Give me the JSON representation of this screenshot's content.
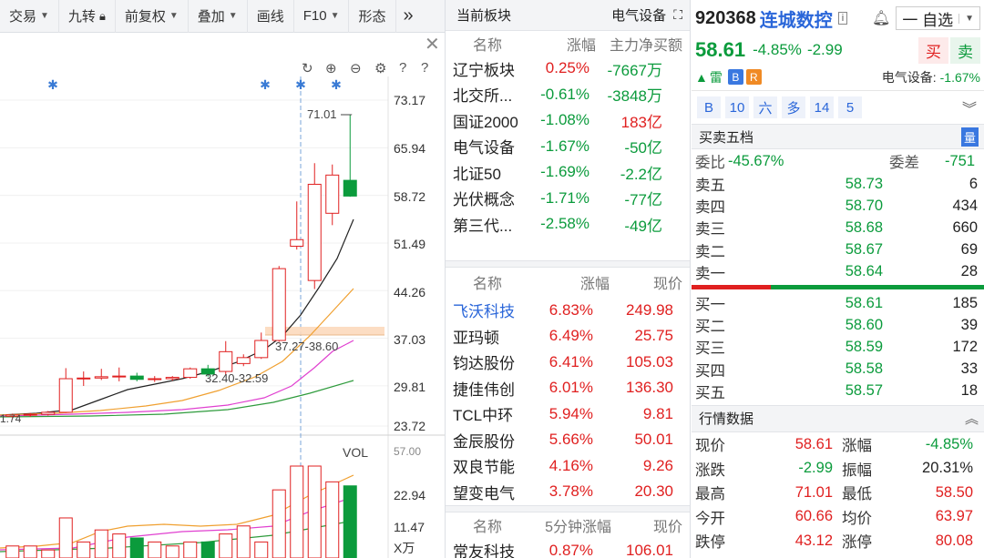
{
  "toolbar": {
    "items": [
      "交易",
      "九转",
      "前复权",
      "叠加",
      "画线",
      "F10",
      "形态"
    ]
  },
  "chart": {
    "y_ticks": [
      "73.17",
      "65.94",
      "58.72",
      "51.49",
      "44.26",
      "37.03",
      "29.81",
      "23.72"
    ],
    "vol_label": "VOL",
    "vol_ticks": [
      "22.94",
      "11.47"
    ],
    "vol_unit": "X万",
    "annotations": {
      "high": "71.01",
      "range1": "37.27-38.60",
      "range2": "32.40-32.59",
      "left_edge": "1.74",
      "left_edge_vol": "57.00"
    }
  },
  "chart_data": {
    "type": "candlestick",
    "y_axis_ticks": [
      73.17,
      65.94,
      58.72,
      51.49,
      44.26,
      37.03,
      29.81,
      23.72
    ],
    "candles": [
      {
        "open": 25.2,
        "high": 25.6,
        "low": 24.9,
        "close": 25.4
      },
      {
        "open": 25.4,
        "high": 25.7,
        "low": 25.1,
        "close": 25.5
      },
      {
        "open": 25.5,
        "high": 26.0,
        "low": 25.3,
        "close": 25.8
      },
      {
        "open": 25.8,
        "high": 32.5,
        "low": 25.7,
        "close": 30.9
      },
      {
        "open": 30.9,
        "high": 32.0,
        "low": 29.8,
        "close": 31.0
      },
      {
        "open": 31.0,
        "high": 32.4,
        "low": 30.7,
        "close": 31.2
      },
      {
        "open": 31.2,
        "high": 32.6,
        "low": 30.5,
        "close": 31.3
      },
      {
        "open": 31.3,
        "high": 31.8,
        "low": 30.5,
        "close": 30.8
      },
      {
        "open": 30.8,
        "high": 31.3,
        "low": 30.4,
        "close": 30.9
      },
      {
        "open": 30.9,
        "high": 31.3,
        "low": 30.6,
        "close": 31.1
      },
      {
        "open": 31.1,
        "high": 32.6,
        "low": 30.9,
        "close": 32.4
      },
      {
        "open": 32.4,
        "high": 33.0,
        "low": 31.2,
        "close": 31.6
      },
      {
        "open": 32.0,
        "high": 36.6,
        "low": 31.5,
        "close": 35.0
      },
      {
        "open": 33.2,
        "high": 34.6,
        "low": 32.8,
        "close": 34.1
      },
      {
        "open": 34.1,
        "high": 37.9,
        "low": 33.9,
        "close": 36.7
      },
      {
        "open": 36.7,
        "high": 48.0,
        "low": 36.5,
        "close": 47.6
      },
      {
        "open": 51.0,
        "high": 57.8,
        "low": 50.5,
        "close": 52.0
      },
      {
        "open": 45.8,
        "high": 63.6,
        "low": 44.5,
        "close": 60.4
      },
      {
        "open": 56.0,
        "high": 63.4,
        "low": 54.2,
        "close": 61.8
      },
      {
        "open": 61.0,
        "high": 71.01,
        "low": 58.5,
        "close": 58.61
      }
    ],
    "volumes": [
      3,
      3,
      2,
      10,
      4,
      7,
      6,
      5,
      4,
      3,
      4,
      4,
      6,
      8,
      4,
      17,
      22.94,
      22.94,
      19,
      18
    ]
  },
  "sector": {
    "title": "当前板块",
    "right_title": "电气设备",
    "columns": [
      "名称",
      "涨幅",
      "主力净买额"
    ],
    "rows": [
      {
        "name": "辽宁板块",
        "change": "0.25%",
        "net": "-7667万"
      },
      {
        "name": "北交所...",
        "change": "-0.61%",
        "net": "-3848万"
      },
      {
        "name": "国证2000",
        "change": "-1.08%",
        "net": "183亿"
      },
      {
        "name": "电气设备",
        "change": "-1.67%",
        "net": "-50亿"
      },
      {
        "name": "北证50",
        "change": "-1.69%",
        "net": "-2.2亿"
      },
      {
        "name": "光伏概念",
        "change": "-1.71%",
        "net": "-77亿"
      },
      {
        "name": "第三代...",
        "change": "-2.58%",
        "net": "-49亿"
      }
    ]
  },
  "members": {
    "columns": [
      "名称",
      "涨幅",
      "现价"
    ],
    "rows": [
      {
        "name": "飞沃科技",
        "change": "6.83%",
        "price": "249.98"
      },
      {
        "name": "亚玛顿",
        "change": "6.49%",
        "price": "25.75"
      },
      {
        "name": "钧达股份",
        "change": "6.41%",
        "price": "105.03"
      },
      {
        "name": "捷佳伟创",
        "change": "6.01%",
        "price": "136.30"
      },
      {
        "name": "TCL中环",
        "change": "5.94%",
        "price": "9.81"
      },
      {
        "name": "金辰股份",
        "change": "5.66%",
        "price": "50.01"
      },
      {
        "name": "双良节能",
        "change": "4.16%",
        "price": "9.26"
      },
      {
        "name": "望变电气",
        "change": "3.78%",
        "price": "20.30"
      }
    ]
  },
  "fivemin": {
    "columns": [
      "名称",
      "5分钟涨幅",
      "现价"
    ],
    "rows": [
      {
        "name": "常友科技",
        "change": "0.87%",
        "price": "106.01"
      }
    ]
  },
  "stock": {
    "code": "920368",
    "name": "连城数控",
    "price": "58.61",
    "change_pct": "-4.85%",
    "change_amt": "-2.99",
    "select_label": "自选",
    "buy_label": "买",
    "sell_label": "卖",
    "lei_label": "雷",
    "badge_b": "B",
    "badge_r": "R",
    "sector_line": "电气设备:",
    "sector_change": "-1.67%",
    "tags": [
      "B",
      "10",
      "六",
      "多",
      "14",
      "5"
    ]
  },
  "orderbook": {
    "title": "买卖五档",
    "qty_icon": "量",
    "ratio_label": "委比",
    "ratio_value": "-45.67%",
    "diff_label": "委差",
    "diff_value": "-751",
    "asks": [
      {
        "label": "卖五",
        "price": "58.73",
        "vol": "6"
      },
      {
        "label": "卖四",
        "price": "58.70",
        "vol": "434"
      },
      {
        "label": "卖三",
        "price": "58.68",
        "vol": "660"
      },
      {
        "label": "卖二",
        "price": "58.67",
        "vol": "69"
      },
      {
        "label": "卖一",
        "price": "58.64",
        "vol": "28"
      }
    ],
    "bids": [
      {
        "label": "买一",
        "price": "58.61",
        "vol": "185"
      },
      {
        "label": "买二",
        "price": "58.60",
        "vol": "39"
      },
      {
        "label": "买三",
        "price": "58.59",
        "vol": "172"
      },
      {
        "label": "买四",
        "price": "58.58",
        "vol": "33"
      },
      {
        "label": "买五",
        "price": "58.57",
        "vol": "18"
      }
    ],
    "bid_share": 0.27
  },
  "quote": {
    "title": "行情数据",
    "rows": [
      {
        "l1": "现价",
        "v1": "58.61",
        "l2": "涨幅",
        "v2": "-4.85%"
      },
      {
        "l1": "涨跌",
        "v1": "-2.99",
        "l2": "振幅",
        "v2": "20.31%"
      },
      {
        "l1": "最高",
        "v1": "71.01",
        "l2": "最低",
        "v2": "58.50"
      },
      {
        "l1": "今开",
        "v1": "60.66",
        "l2": "均价",
        "v2": "63.97"
      },
      {
        "l1": "跌停",
        "v1": "43.12",
        "l2": "涨停",
        "v2": "80.08"
      }
    ]
  }
}
